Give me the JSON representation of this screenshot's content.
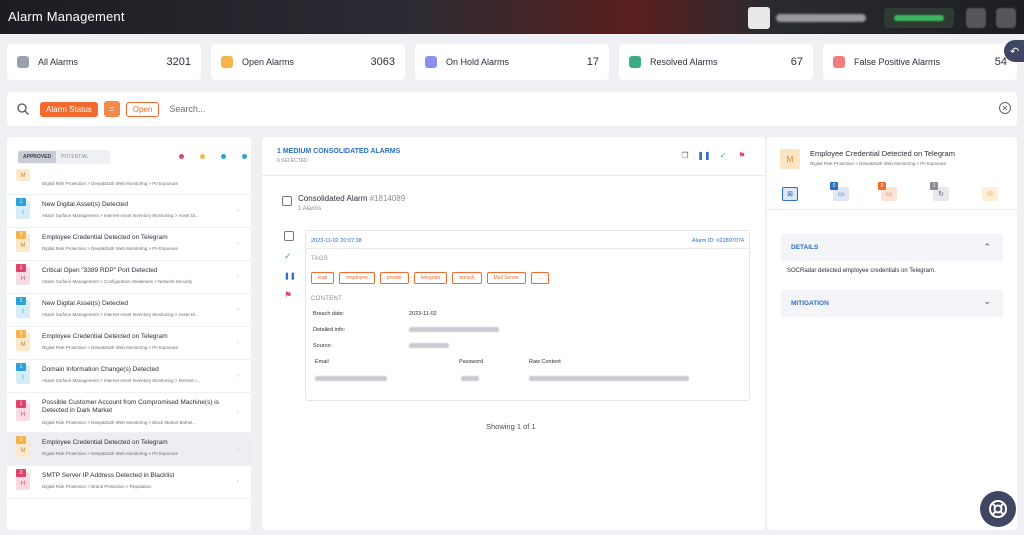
{
  "app": {
    "title": "Alarm Management"
  },
  "stats": [
    {
      "label": "All Alarms",
      "count": "3201",
      "color": "#9aa0ab"
    },
    {
      "label": "Open Alarms",
      "count": "3063",
      "color": "#f6b54c"
    },
    {
      "label": "On Hold Alarms",
      "count": "17",
      "color": "#8e8ef0"
    },
    {
      "label": "Resolved Alarms",
      "count": "67",
      "color": "#3dac86"
    },
    {
      "label": "False Positive Alarms",
      "count": "54",
      "color": "#f07e7e"
    }
  ],
  "search": {
    "filter_label": "Alarm Status",
    "operator": "=",
    "value": "Open",
    "placeholder": "Search..."
  },
  "list": {
    "tab_approved": "APPROVED",
    "tab_potential": "POTENTIAL",
    "dot_colors": [
      "#e0426e",
      "#f6b54c",
      "#2ba2d9",
      "#2ba2d9"
    ],
    "items": [
      {
        "level": "M",
        "count": "",
        "title": "",
        "path": "Digital Risk Protection > Deep&Dark Web Monitoring > PII Exposure",
        "color": "#f6b54c",
        "bg": "#fbe9cc",
        "partial": true
      },
      {
        "level": "I",
        "count": "1",
        "title": "New Digital Asset(s) Detected",
        "path": "Attack Surface Management > Internet Asset Inventory Monitoring > Asset Di...",
        "color": "#2ba2d9",
        "bg": "#d6ecf7"
      },
      {
        "level": "M",
        "count": "2",
        "title": "Employee Credential Detected on Telegram",
        "path": "Digital Risk Protection > Deep&Dark Web Monitoring > PII Exposure",
        "color": "#f6b54c",
        "bg": "#fbe9cc"
      },
      {
        "level": "H",
        "count": "1",
        "title": "Critical Open \"3389 RDP\" Port Detected",
        "path": "Attack Surface Management > Configuration Weakness > Network Security",
        "color": "#e0426e",
        "bg": "#f9dbe4"
      },
      {
        "level": "I",
        "count": "1",
        "title": "New Digital Asset(s) Detected",
        "path": "Attack Surface Management > Internet Asset Inventory Monitoring > Asset Di...",
        "color": "#2ba2d9",
        "bg": "#d6ecf7"
      },
      {
        "level": "M",
        "count": "5",
        "title": "Employee Credential Detected on Telegram",
        "path": "Digital Risk Protection > Deep&Dark Web Monitoring > PII Exposure",
        "color": "#f6b54c",
        "bg": "#fbe9cc"
      },
      {
        "level": "I",
        "count": "1",
        "title": "Domain Information Change(s) Detected",
        "path": "Attack Surface Management > Internet Asset Inventory Monitoring > Domain I...",
        "color": "#2ba2d9",
        "bg": "#d6ecf7"
      },
      {
        "level": "H",
        "count": "1",
        "title": "Possible Customer Account from Compromised Machine(s) is Detected in Dark Market",
        "path": "Digital Risk Protection > Deep&Dark Web Monitoring > Black Market Botnet...",
        "color": "#e0426e",
        "bg": "#f9dbe4",
        "tall": true
      },
      {
        "level": "M",
        "count": "1",
        "title": "Employee Credential Detected on Telegram",
        "path": "Digital Risk Protection > Deep&Dark Web Monitoring > PII Exposure",
        "color": "#f6b54c",
        "bg": "#fbe9cc",
        "selected": true
      },
      {
        "level": "H",
        "count": "2",
        "title": "SMTP Server IP Address Detected in Blacklist",
        "path": "Digital Risk Protection > Brand Protection > Reputation",
        "color": "#e0426e",
        "bg": "#f9dbe4"
      }
    ]
  },
  "middle": {
    "header": "1 MEDIUM CONSOLIDATED ALARMS",
    "selected": "0 SELECTED",
    "consolidated_title": "Consolidated Alarm",
    "consolidated_id": "#1814089",
    "consolidated_sub": "1 Alarms",
    "date": "2023-11-02 20:07:38",
    "alarm_id": "Alarm ID: #22897074",
    "tags_label": "TAGS",
    "tags": [
      "leak",
      "employee",
      "private",
      "telegram",
      "breach",
      "Mail Server",
      "..."
    ],
    "content_label": "CONTENT",
    "breach_date_label": "Breach date:",
    "breach_date": "2023-11-02",
    "detailed_info_label": "Detailed info:",
    "source_label": "Source:",
    "col_email": "Email",
    "col_password": "Password",
    "col_raw": "Raw Content",
    "showing": "Showing 1 of 1"
  },
  "right": {
    "level": "M",
    "title": "Employee Credential Detected on Telegram",
    "path": "Digital Risk Protection > Deep&Dark Web Monitoring > PII Exposure",
    "tabs": [
      {
        "icon": "details-icon",
        "badge": "",
        "color": "#2b6fc2",
        "bg": "#dfe7f6"
      },
      {
        "icon": "comment-icon",
        "badge": "0",
        "color": "#2b6fc2",
        "bg": "#dfe7f6"
      },
      {
        "icon": "chat-icon",
        "badge": "0",
        "color": "#f26a2e",
        "bg": "#fde3d6"
      },
      {
        "icon": "history-icon",
        "badge": "1",
        "color": "#5a5d66",
        "bg": "#e7e8ec"
      },
      {
        "icon": "mail-icon",
        "badge": "",
        "color": "#f6b54c",
        "bg": "#fdf0d6"
      }
    ],
    "details_label": "DETAILS",
    "details_text": "SOCRadar detected employee credentials on Telegram.",
    "mitigation_label": "MITIGATION"
  }
}
